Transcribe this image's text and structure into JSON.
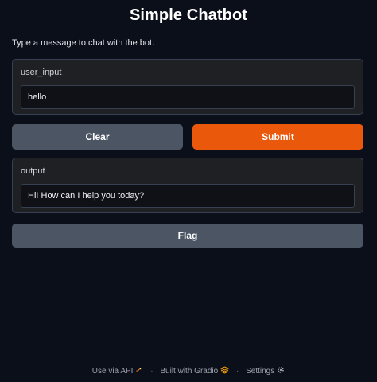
{
  "app": {
    "title": "Simple Chatbot",
    "description": "Type a message to chat with the bot."
  },
  "input": {
    "label": "user_input",
    "value": "hello"
  },
  "buttons": {
    "clear": "Clear",
    "submit": "Submit",
    "flag": "Flag"
  },
  "output": {
    "label": "output",
    "value": "Hi! How can I help you today?"
  },
  "footer": {
    "api": "Use via API",
    "built": "Built with Gradio",
    "settings": "Settings",
    "separator": "·"
  },
  "colors": {
    "accent": "#ea580c",
    "background": "#0b0f19",
    "panel": "#1f2023",
    "secondary_button": "#4b5563"
  },
  "icons": {
    "api": "rocket-icon",
    "gradio": "gradio-logo-icon",
    "settings": "gear-icon"
  }
}
